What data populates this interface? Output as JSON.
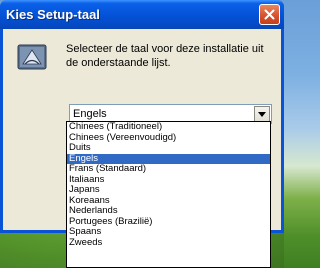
{
  "dialog": {
    "title": "Kies Setup-taal",
    "message": "Selecteer de taal voor deze installatie uit de onderstaande lijst.",
    "icon": "setup-icon",
    "close_icon": "close-icon"
  },
  "language_select": {
    "selected": "Engels",
    "arrow_icon": "chevron-down-icon",
    "options": [
      "Chinees (Traditioneel)",
      "Chinees (Vereenvoudigd)",
      "Duits",
      "Engels",
      "Frans (Standaard)",
      "Italiaans",
      "Japans",
      "Koreaans",
      "Nederlands",
      "Portugees (Brazilië)",
      "Spaans",
      "Zweeds"
    ],
    "highlighted_index": 3
  },
  "colors": {
    "titlebar": "#0553d8",
    "highlight": "#316ac5",
    "dialog_bg": "#ece9d8",
    "close_button": "#d8532d"
  }
}
